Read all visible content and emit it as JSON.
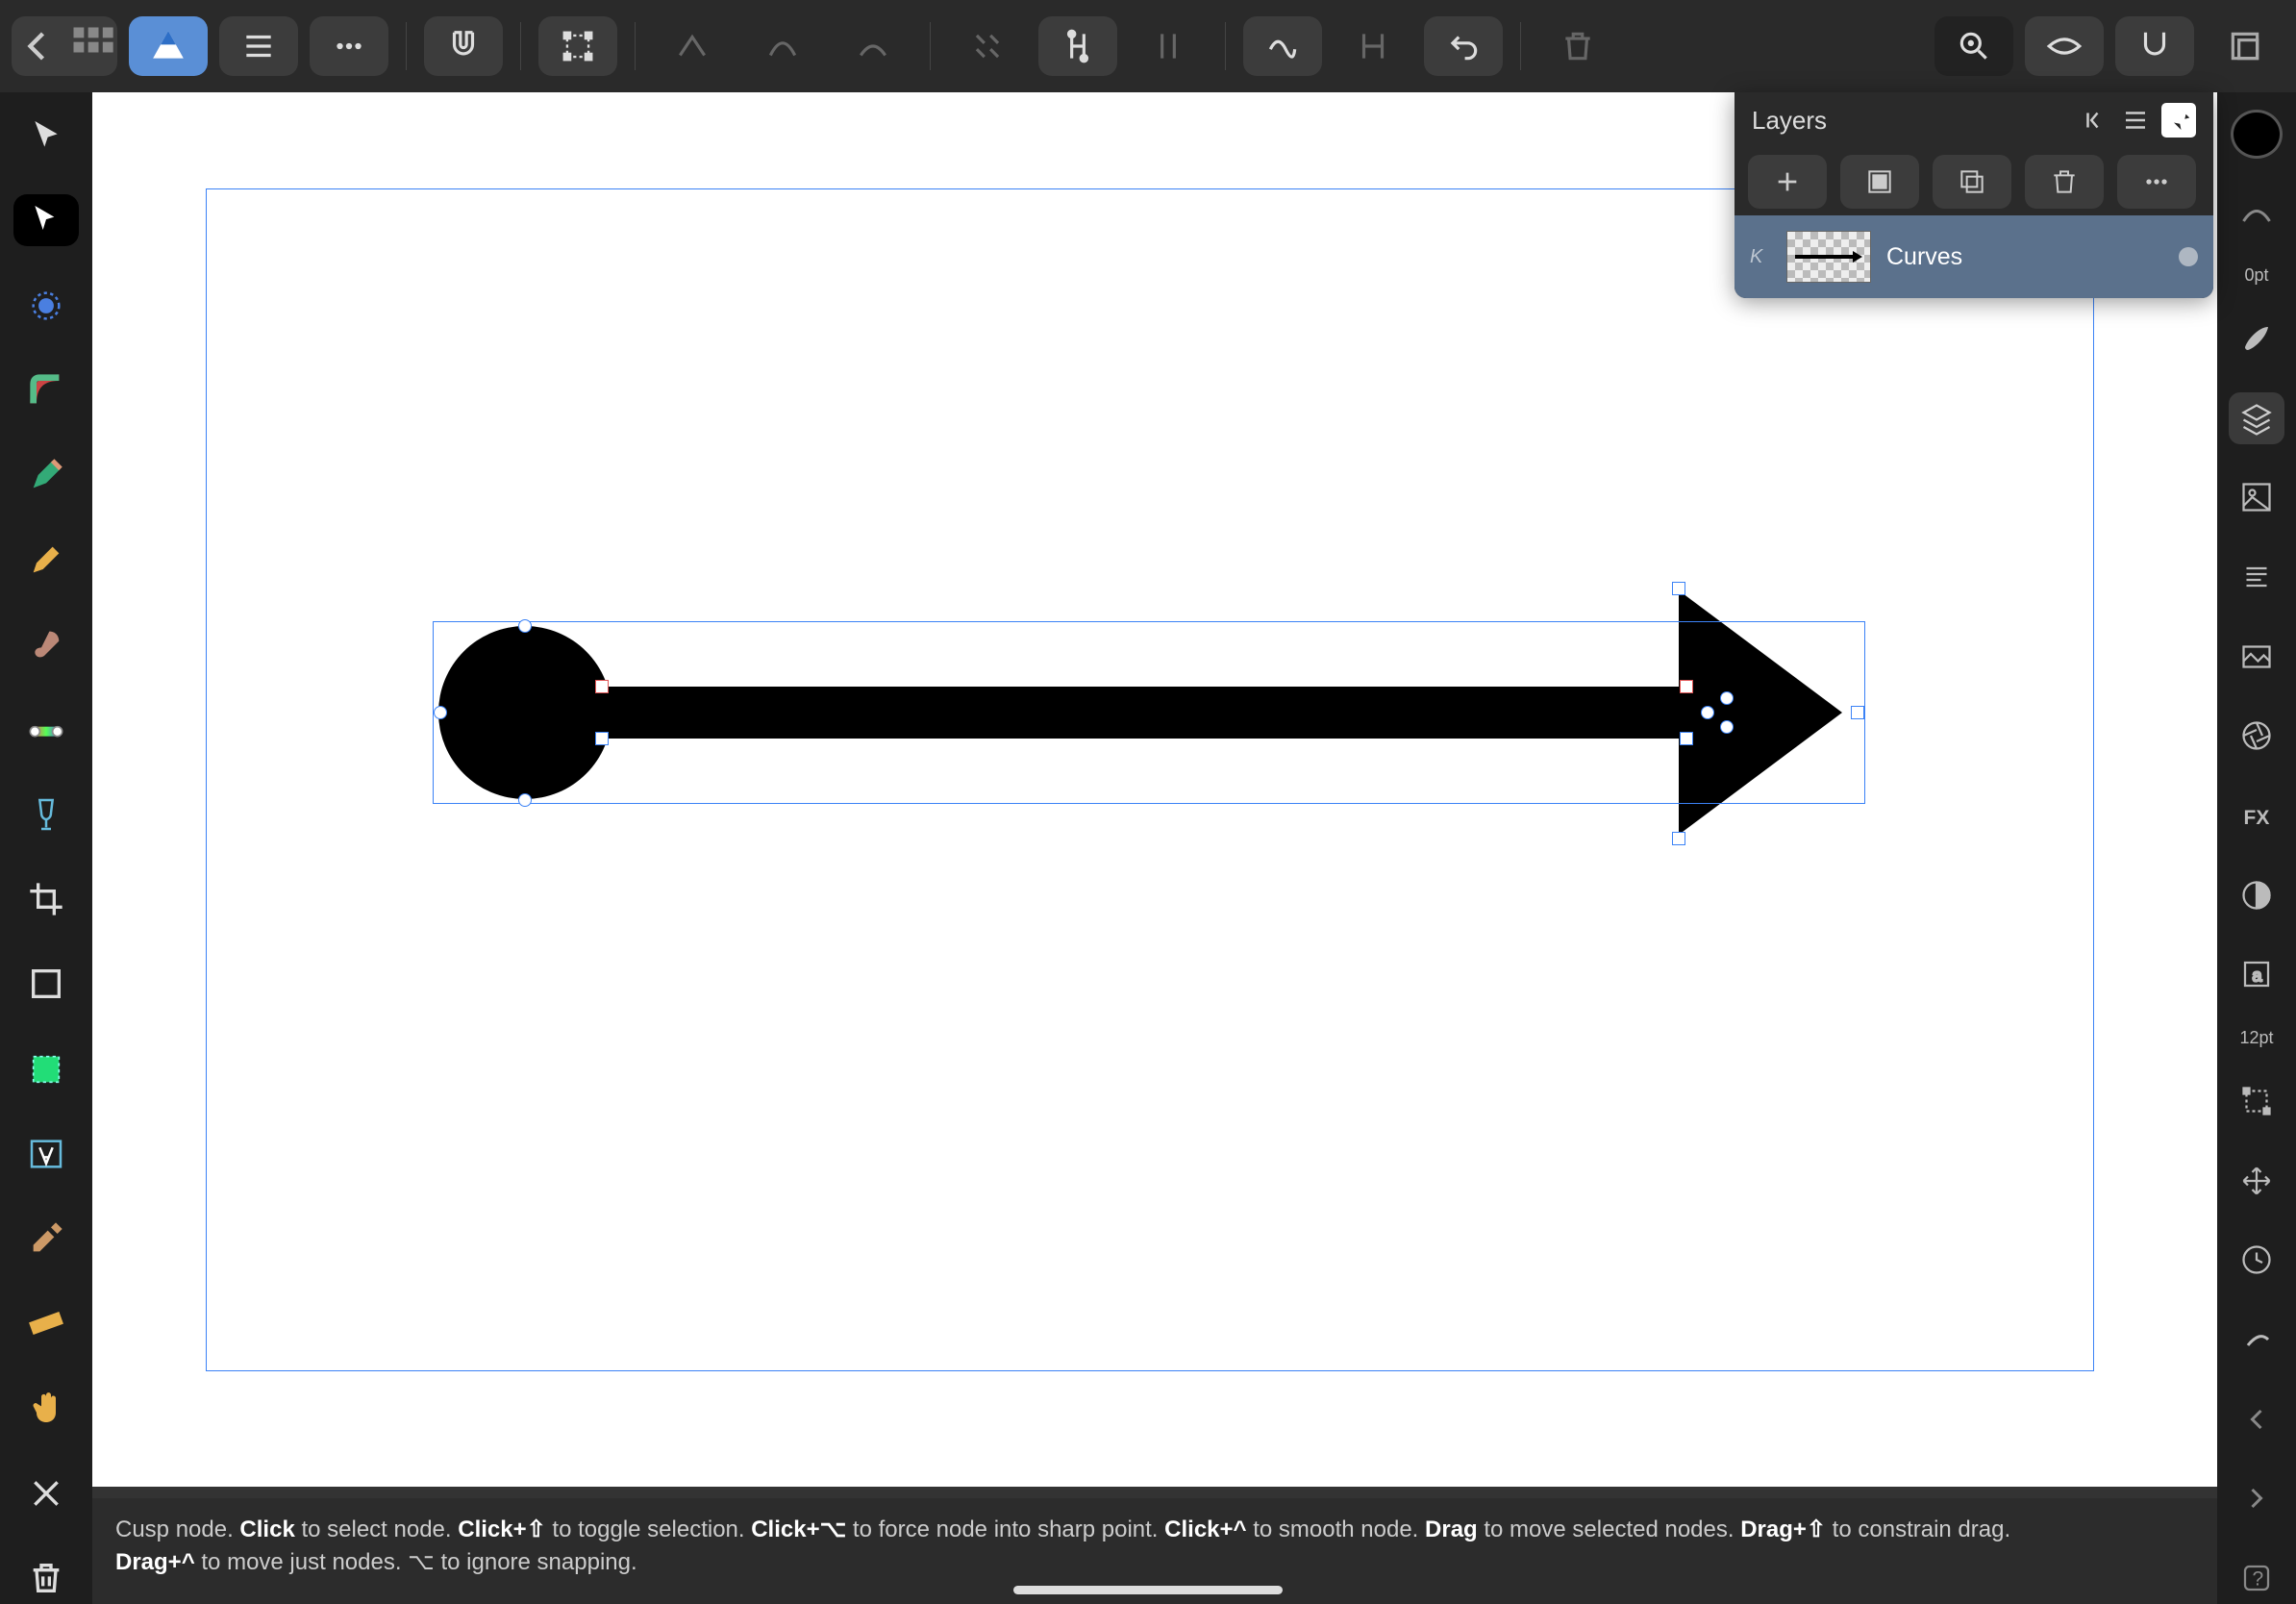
{
  "topbar": {
    "back_icon": "arrow-left",
    "grid_icon": "grid"
  },
  "context": {
    "width_value": "0.0pt"
  },
  "right": {
    "stroke_label": "0pt",
    "char_label": "12pt"
  },
  "layers": {
    "title": "Layers",
    "items": [
      {
        "tag": "K",
        "name": "Curves"
      }
    ]
  },
  "status": {
    "l1_a": "Cusp node. ",
    "l1_b": "Click",
    "l1_c": " to select node. ",
    "l1_d": "Click+⇧",
    "l1_e": " to toggle selection. ",
    "l1_f": "Click+⌥",
    "l1_g": " to force node into sharp point. ",
    "l1_h": "Click+^",
    "l1_i": " to smooth node. ",
    "l1_j": "Drag",
    "l1_k": " to move selected nodes. ",
    "l1_l": "Drag+⇧",
    "l1_m": " to constrain drag. ",
    "l2_a": "Drag+^",
    "l2_b": " to move just nodes. ⌥ to ignore snapping."
  }
}
